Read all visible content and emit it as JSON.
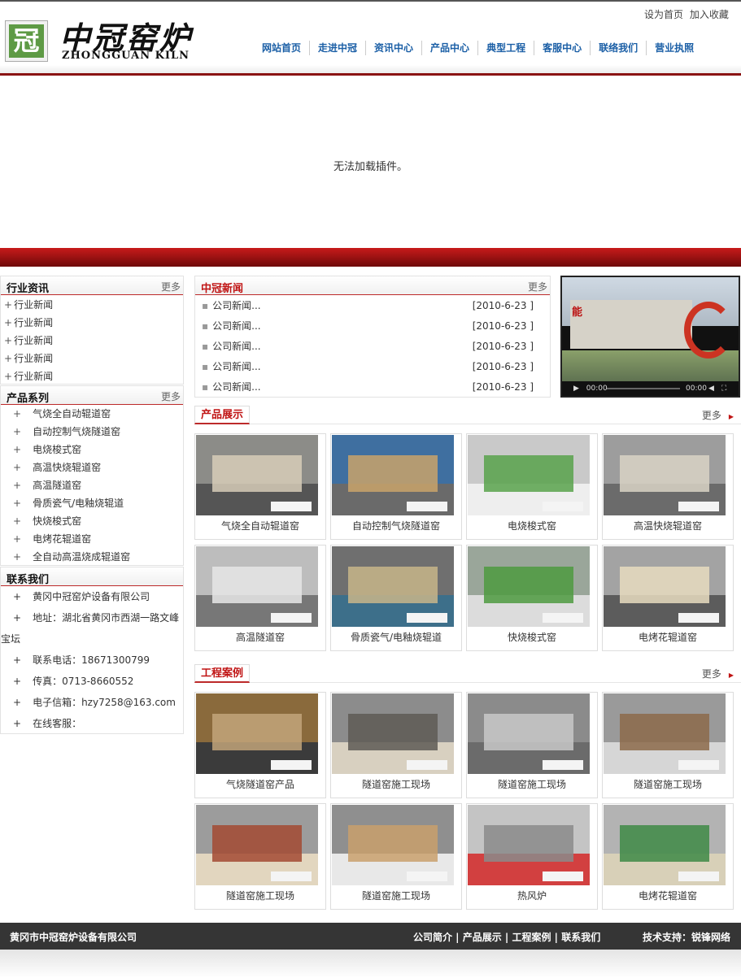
{
  "header": {
    "logo_char": "冠",
    "logo_cn": "中冠窑炉",
    "logo_en": "ZHONGGUAN KILN",
    "top_links": [
      "设为首页",
      "加入收藏"
    ],
    "nav": [
      "网站首页",
      "走进中冠",
      "资讯中心",
      "产品中心",
      "典型工程",
      "客服中心",
      "联络我们",
      "营业执照"
    ]
  },
  "plugin_message": "无法加载插件。",
  "industry": {
    "title": "行业资讯",
    "more": "更多",
    "items": [
      "行业新闻",
      "行业新闻",
      "行业新闻",
      "行业新闻",
      "行业新闻"
    ]
  },
  "products_side": {
    "title": "产品系列",
    "more": "更多",
    "items": [
      "气烧全自动辊道窑",
      "自动控制气烧隧道窑",
      "电烧梭式窑",
      "高温快烧辊道窑",
      "高温隧道窑",
      "骨质瓷气/电釉烧辊道",
      "快烧梭式窑",
      "电烤花辊道窑",
      "全自动高温烧成辊道窑"
    ]
  },
  "contact": {
    "title": "联系我们",
    "items": [
      "黄冈中冠窑炉设备有限公司",
      "地址：湖北省黄冈市西湖一路文峰宝坛",
      "联系电话：18671300799",
      "传真：0713-8660552",
      "电子信箱：hzy7258@163.com",
      "在线客服："
    ]
  },
  "news": {
    "title": "中冠新闻",
    "more": "更多",
    "items": [
      {
        "title": "公司新闻...",
        "date": "[2010-6-23 ]"
      },
      {
        "title": "公司新闻...",
        "date": "[2010-6-23 ]"
      },
      {
        "title": "公司新闻...",
        "date": "[2010-6-23 ]"
      },
      {
        "title": "公司新闻...",
        "date": "[2010-6-23 ]"
      },
      {
        "title": "公司新闻...",
        "date": "[2010-6-23 ]"
      }
    ]
  },
  "video": {
    "sign_char": "能",
    "time_left": "00:00",
    "time_right": "00:00"
  },
  "showcase": {
    "title": "产品展示",
    "more": "更多",
    "items": [
      "气烧全自动辊道窑",
      "自动控制气烧隧道窑",
      "电烧梭式窑",
      "高温快烧辊道窑",
      "高温隧道窑",
      "骨质瓷气/电釉烧辊道",
      "快烧梭式窑",
      "电烤花辊道窑"
    ]
  },
  "cases": {
    "title": "工程案例",
    "more": "更多",
    "items": [
      "气烧隧道窑产品",
      "隧道窑施工现场",
      "隧道窑施工现场",
      "隧道窑施工现场",
      "隧道窑施工现场",
      "隧道窑施工现场",
      "热风炉",
      "电烤花辊道窑"
    ]
  },
  "footer": {
    "company": "黄冈市中冠窑炉设备有限公司",
    "links": "公司简介 | 产品展示 | 工程案例 | 联系我们",
    "support": "技术支持：锐锋网络"
  }
}
